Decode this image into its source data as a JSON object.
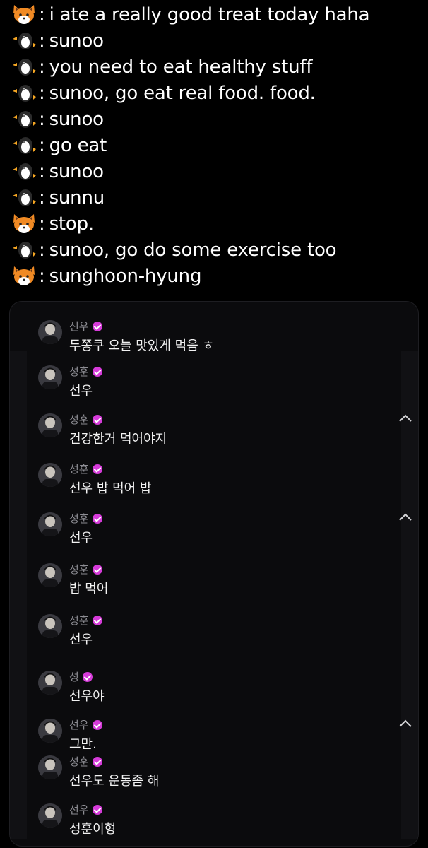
{
  "translation": [
    {
      "speaker": "fox",
      "text": "i ate a really good treat today haha"
    },
    {
      "speaker": "penguin",
      "text": "sunoo"
    },
    {
      "speaker": "penguin",
      "text": "you need to eat healthy stuff"
    },
    {
      "speaker": "penguin",
      "text": "sunoo, go eat real food. food."
    },
    {
      "speaker": "penguin",
      "text": "sunoo"
    },
    {
      "speaker": "penguin",
      "text": "go eat"
    },
    {
      "speaker": "penguin",
      "text": "sunoo"
    },
    {
      "speaker": "penguin",
      "text": "sunnu"
    },
    {
      "speaker": "fox",
      "text": "stop."
    },
    {
      "speaker": "penguin",
      "text": "sunoo, go do some exercise too"
    },
    {
      "speaker": "fox",
      "text": "sunghoon-hyung"
    }
  ],
  "colon": ":",
  "icons": {
    "fox": "fox-face-icon",
    "penguin": "penguin-icon"
  },
  "card_messages": [
    {
      "name": "선우",
      "text": "두쫑쿠 오늘 맛있게 먹음 ㅎ",
      "chevron": false
    },
    {
      "name": "성훈",
      "text": "선우",
      "chevron": false
    },
    {
      "name": "성훈",
      "text": "건강한거 먹어야지",
      "chevron": true
    },
    {
      "name": "성훈",
      "text": "선우 밥 먹어 밥",
      "chevron": false
    },
    {
      "name": "성훈",
      "text": "선우",
      "chevron": true
    },
    {
      "name": "성훈",
      "text": "밥 먹어",
      "chevron": false
    },
    {
      "name": "성훈",
      "text": "선우",
      "chevron": false
    },
    {
      "name": "성",
      "text": "선우야",
      "chevron": false
    },
    {
      "name": "선우",
      "text": "그만.",
      "chevron": true
    },
    {
      "name": "성훈",
      "text": "선우도 운동좀 해",
      "chevron": false
    },
    {
      "name": "선우",
      "text": "성훈이형",
      "chevron": false
    }
  ],
  "colors": {
    "background": "#000000",
    "card": "#0b0b0d",
    "name": "#8d8d93",
    "verified_badge": "#d63bd9"
  }
}
